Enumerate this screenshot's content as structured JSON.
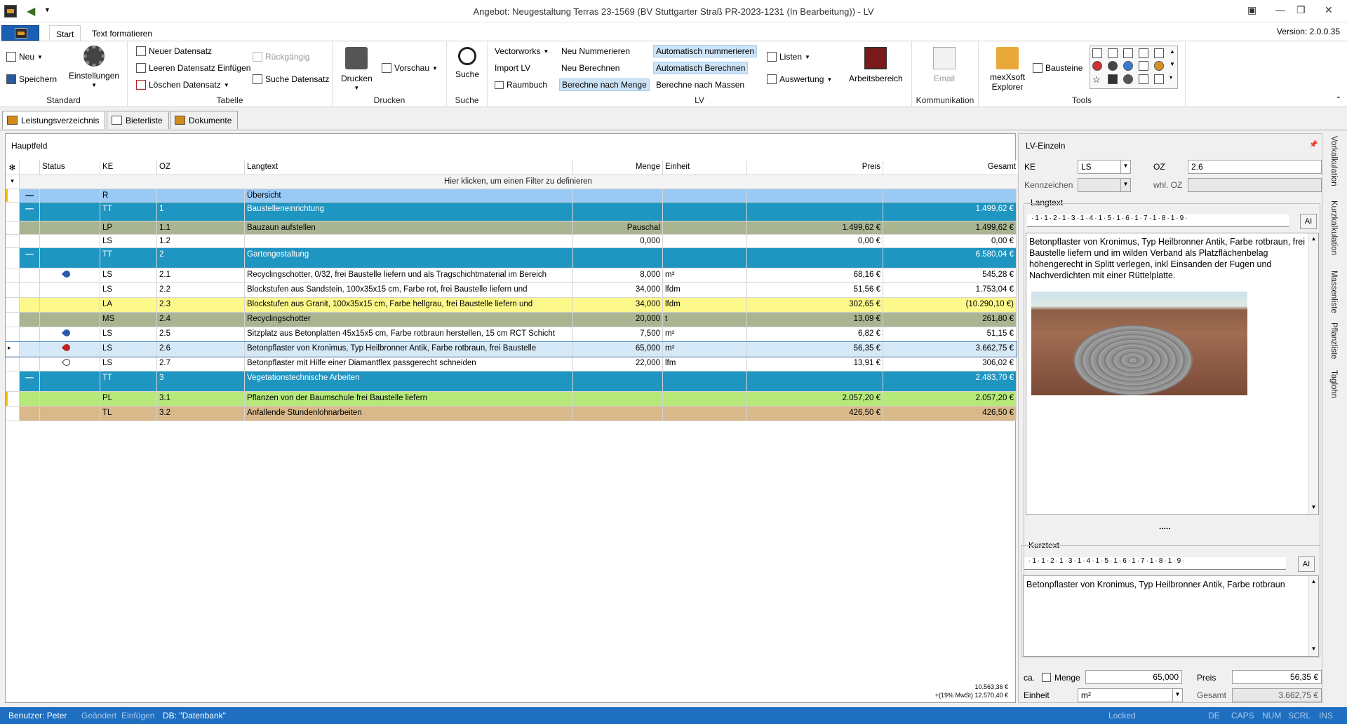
{
  "window": {
    "title": "Angebot: Neugestaltung Terras 23-1569 (BV Stuttgarter Straß PR-2023-1231 (In Bearbeitung)) - LV",
    "version": "Version: 2.0.0.35"
  },
  "ribbon_tabs": [
    "Start",
    "Text formatieren"
  ],
  "ribbon": {
    "standard": {
      "label": "Standard",
      "neu": "Neu",
      "speichern": "Speichern",
      "einstellungen": "Einstellungen"
    },
    "tabelle": {
      "label": "Tabelle",
      "neuer": "Neuer Datensatz",
      "leeren": "Leeren Datensatz Einfügen",
      "loeschen": "Löschen Datensatz",
      "rueck": "Rückgängig",
      "suche": "Suche Datensatz"
    },
    "drucken": {
      "label": "Drucken",
      "drucken": "Drucken",
      "vorschau": "Vorschau"
    },
    "suche": {
      "label": "Suche",
      "suche": "Suche"
    },
    "lv": {
      "label": "LV",
      "vectorworks": "Vectorworks",
      "import": "Import LV",
      "raumbuch": "Raumbuch",
      "neu_num": "Neu Nummerieren",
      "neu_ber": "Neu Berechnen",
      "ber_menge": "Berechne nach Menge",
      "auto_num": "Automatisch nummerieren",
      "auto_ber": "Automatisch Berechnen",
      "ber_massen": "Berechne nach Massen",
      "listen": "Listen",
      "auswertung": "Auswertung",
      "arbeitsbereich": "Arbeitsbereich"
    },
    "kommunikation": {
      "label": "Kommunikation",
      "email": "Email"
    },
    "tools": {
      "label": "Tools",
      "explorer1": "mexXsoft",
      "explorer2": "Explorer",
      "bausteine": "Bausteine"
    }
  },
  "view_tabs": [
    "Leistungsverzeichnis",
    "Bieterliste",
    "Dokumente"
  ],
  "main": {
    "title": "Hauptfeld",
    "columns": [
      "Status",
      "KE",
      "OZ",
      "Langtext",
      "Menge",
      "Einheit",
      "Preis",
      "Gesamt"
    ],
    "filter_hint": "Hier klicken, um einen Filter zu definieren",
    "rows": [
      {
        "marker": "—",
        "status": "",
        "ke": "R",
        "oz": "",
        "text": "Übersicht",
        "menge": "",
        "einheit": "",
        "preis": "",
        "gesamt": "",
        "bg": "#99c9f5",
        "fg": "#000",
        "h": 19,
        "yellowbar": true
      },
      {
        "marker": "—",
        "status": "",
        "ke": "TT",
        "oz": "1",
        "text": "Baustelleneinrichtung",
        "menge": "",
        "einheit": "",
        "preis": "",
        "gesamt": "1.499,62 €",
        "bg": "#1f95c2",
        "fg": "#fff",
        "h": 27
      },
      {
        "marker": "",
        "status": "",
        "ke": "LP",
        "oz": "1.1",
        "text": "Bauzaun aufstellen",
        "menge": "Pauschal",
        "einheit": "",
        "preis": "1.499,62 €",
        "gesamt": "1.499,62 €",
        "bg": "#a9b591",
        "fg": "#000",
        "h": 19
      },
      {
        "marker": "",
        "status": "",
        "ke": "LS",
        "oz": "1.2",
        "text": "",
        "menge": "0,000",
        "einheit": "",
        "preis": "0,00 €",
        "gesamt": "0,00 €",
        "bg": "#fff",
        "fg": "#000",
        "h": 19
      },
      {
        "marker": "—",
        "status": "",
        "ke": "TT",
        "oz": "2",
        "text": "Gartengestaltung",
        "menge": "",
        "einheit": "",
        "preis": "",
        "gesamt": "6.580,04 €",
        "bg": "#1f95c2",
        "fg": "#fff",
        "h": 29
      },
      {
        "marker": "",
        "status": "pin-blue",
        "ke": "LS",
        "oz": "2.1",
        "text": "Recyclingschotter, 0/32, frei Baustelle liefern und als Tragschichtmaterial im Bereich",
        "menge": "8,000",
        "einheit": "m³",
        "preis": "68,16 €",
        "gesamt": "545,28 €",
        "bg": "#fff",
        "fg": "#000",
        "h": 21
      },
      {
        "marker": "",
        "status": "",
        "ke": "LS",
        "oz": "2.2",
        "text": "Blockstufen aus Sandstein, 100x35x15 cm, Farbe rot, frei Baustelle liefern und",
        "menge": "34,000",
        "einheit": "lfdm",
        "preis": "51,56 €",
        "gesamt": "1.753,04 €",
        "bg": "#fff",
        "fg": "#000",
        "h": 21
      },
      {
        "marker": "",
        "status": "",
        "ke": "LA",
        "oz": "2.3",
        "text": "Blockstufen aus Granit, 100x35x15 cm, Farbe hellgrau, frei Baustelle liefern und",
        "menge": "34,000",
        "einheit": "lfdm",
        "preis": "302,65 €",
        "gesamt": "(10.290,10 €)",
        "bg": "#fdf88a",
        "fg": "#000",
        "h": 21
      },
      {
        "marker": "",
        "status": "",
        "ke": "MS",
        "oz": "2.4",
        "text": "Recyclingschotter",
        "menge": "20,000",
        "einheit": "t",
        "preis": "13,09 €",
        "gesamt": "261,80 €",
        "bg": "#a9b591",
        "fg": "#000",
        "h": 21
      },
      {
        "marker": "",
        "status": "pin-blue",
        "ke": "LS",
        "oz": "2.5",
        "text": "Sitzplatz aus Betonplatten 45x15x5 cm, Farbe rotbraun herstellen, 15 cm RCT Schicht",
        "menge": "7,500",
        "einheit": "m²",
        "preis": "6,82 €",
        "gesamt": "51,15 €",
        "bg": "#fff",
        "fg": "#000",
        "h": 21
      },
      {
        "marker": "▸",
        "status": "pin-red",
        "ke": "LS",
        "oz": "2.6",
        "text": "Betonpflaster von Kronimus, Typ Heilbronner Antik, Farbe rotbraun, frei Baustelle",
        "menge": "65,000",
        "einheit": "m²",
        "preis": "56,35 €",
        "gesamt": "3.662,75 €",
        "bg": "#d6e9f8",
        "fg": "#000",
        "h": 21,
        "selected": true
      },
      {
        "marker": "",
        "status": "pin-white",
        "ke": "LS",
        "oz": "2.7",
        "text": "Betonpflaster mit Hilfe einer Diamantflex passgerecht schneiden",
        "menge": "22,000",
        "einheit": "lfm",
        "preis": "13,91 €",
        "gesamt": "306,02 €",
        "bg": "#fff",
        "fg": "#000",
        "h": 21
      },
      {
        "marker": "—",
        "status": "",
        "ke": "TT",
        "oz": "3",
        "text": "Vegetationstechnische Arbeiten",
        "menge": "",
        "einheit": "",
        "preis": "",
        "gesamt": "2.483,70 €",
        "bg": "#1f95c2",
        "fg": "#fff",
        "h": 29
      },
      {
        "marker": "",
        "status": "",
        "ke": "PL",
        "oz": "3.1",
        "text": "Pflanzen von der Baumschule frei Baustelle liefern",
        "menge": "",
        "einheit": "",
        "preis": "2.057,20 €",
        "gesamt": "2.057,20 €",
        "bg": "#b6e87a",
        "fg": "#000",
        "h": 21,
        "yellowbar": true
      },
      {
        "marker": "",
        "status": "",
        "ke": "TL",
        "oz": "3.2",
        "text": "Anfallende Stundenlohnarbeiten",
        "menge": "",
        "einheit": "",
        "preis": "426,50 €",
        "gesamt": "426,50 €",
        "bg": "#d9b98a",
        "fg": "#000",
        "h": 21
      }
    ],
    "sum1": "10.563,36 €",
    "sum2": "+(19% MwSt) 12.570,40 €"
  },
  "side": {
    "title": "LV-Einzeln",
    "ke_label": "KE",
    "ke_value": "LS",
    "oz_label": "OZ",
    "oz_value": "2.6",
    "kenn_label": "Kennzeichen",
    "whl_label": "whl. OZ",
    "langtext_label": "Langtext",
    "ruler": "·1·1·2·1·3·1·4·1·5·1·6·1·7·1·8·1·9·",
    "ai": "AI",
    "langtext": "Betonpflaster von Kronimus, Typ Heilbronner Antik, Farbe rotbraun, frei Baustelle liefern und im wilden Verband als Platzflächenbelag höhengerecht in Splitt verlegen, inkl Einsanden der Fugen und Nachverdichten mit einer Rüttelplatte.",
    "dots": ".....",
    "kurztext_label": "Kurztext",
    "kurztext": "Betonpflaster von Kronimus, Typ Heilbronner Antik, Farbe rotbraun",
    "ca_label": "ca.",
    "menge_label": "Menge",
    "menge_value": "65,000",
    "preis_label": "Preis",
    "preis_value": "56,35 €",
    "einheit_label": "Einheit",
    "einheit_value": "m²",
    "gesamt_label": "Gesamt",
    "gesamt_value": "3.662,75 €"
  },
  "right_tabs": [
    "Vorkalkulation",
    "Kurzkalkulation",
    "Massenliste",
    "Pflanzliste",
    "Taglohn"
  ],
  "status": {
    "user": "Benutzer: Peter",
    "geaendert": "Geändert",
    "einfuegen": "Einfügen",
    "db": "DB: \"Datenbank\"",
    "locked": "Locked",
    "de": "DE",
    "caps": "CAPS",
    "num": "NUM",
    "scrl": "SCRL",
    "ins": "INS"
  }
}
